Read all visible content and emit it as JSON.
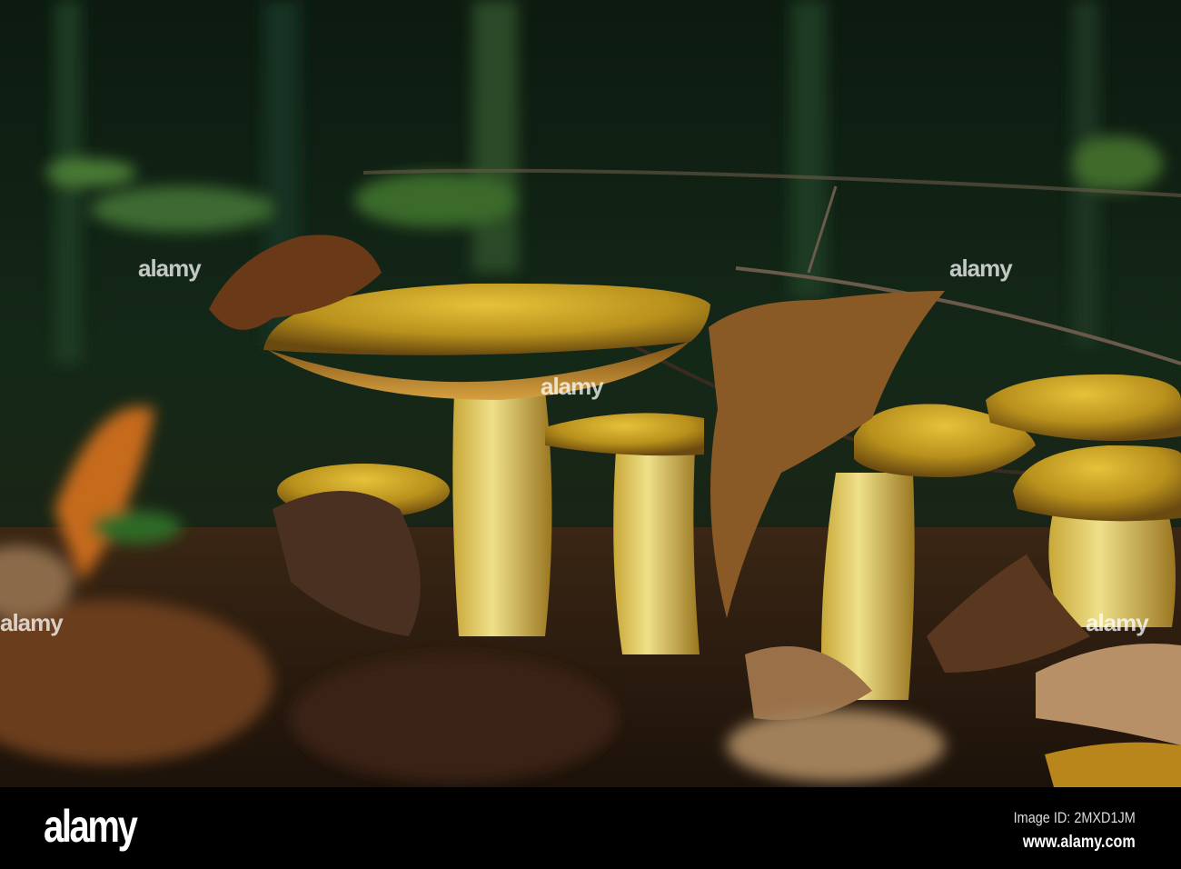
{
  "watermark": {
    "text": "alamy"
  },
  "footer": {
    "logo": "alamy",
    "image_id": "Image ID: 2MXD1JM",
    "url": "www.alamy.com"
  },
  "colors": {
    "background": "#0f1d12",
    "cap": "#c9a524",
    "stem": "#e0cf6a",
    "leaf": "#7a4a1e",
    "footer": "#000000"
  }
}
